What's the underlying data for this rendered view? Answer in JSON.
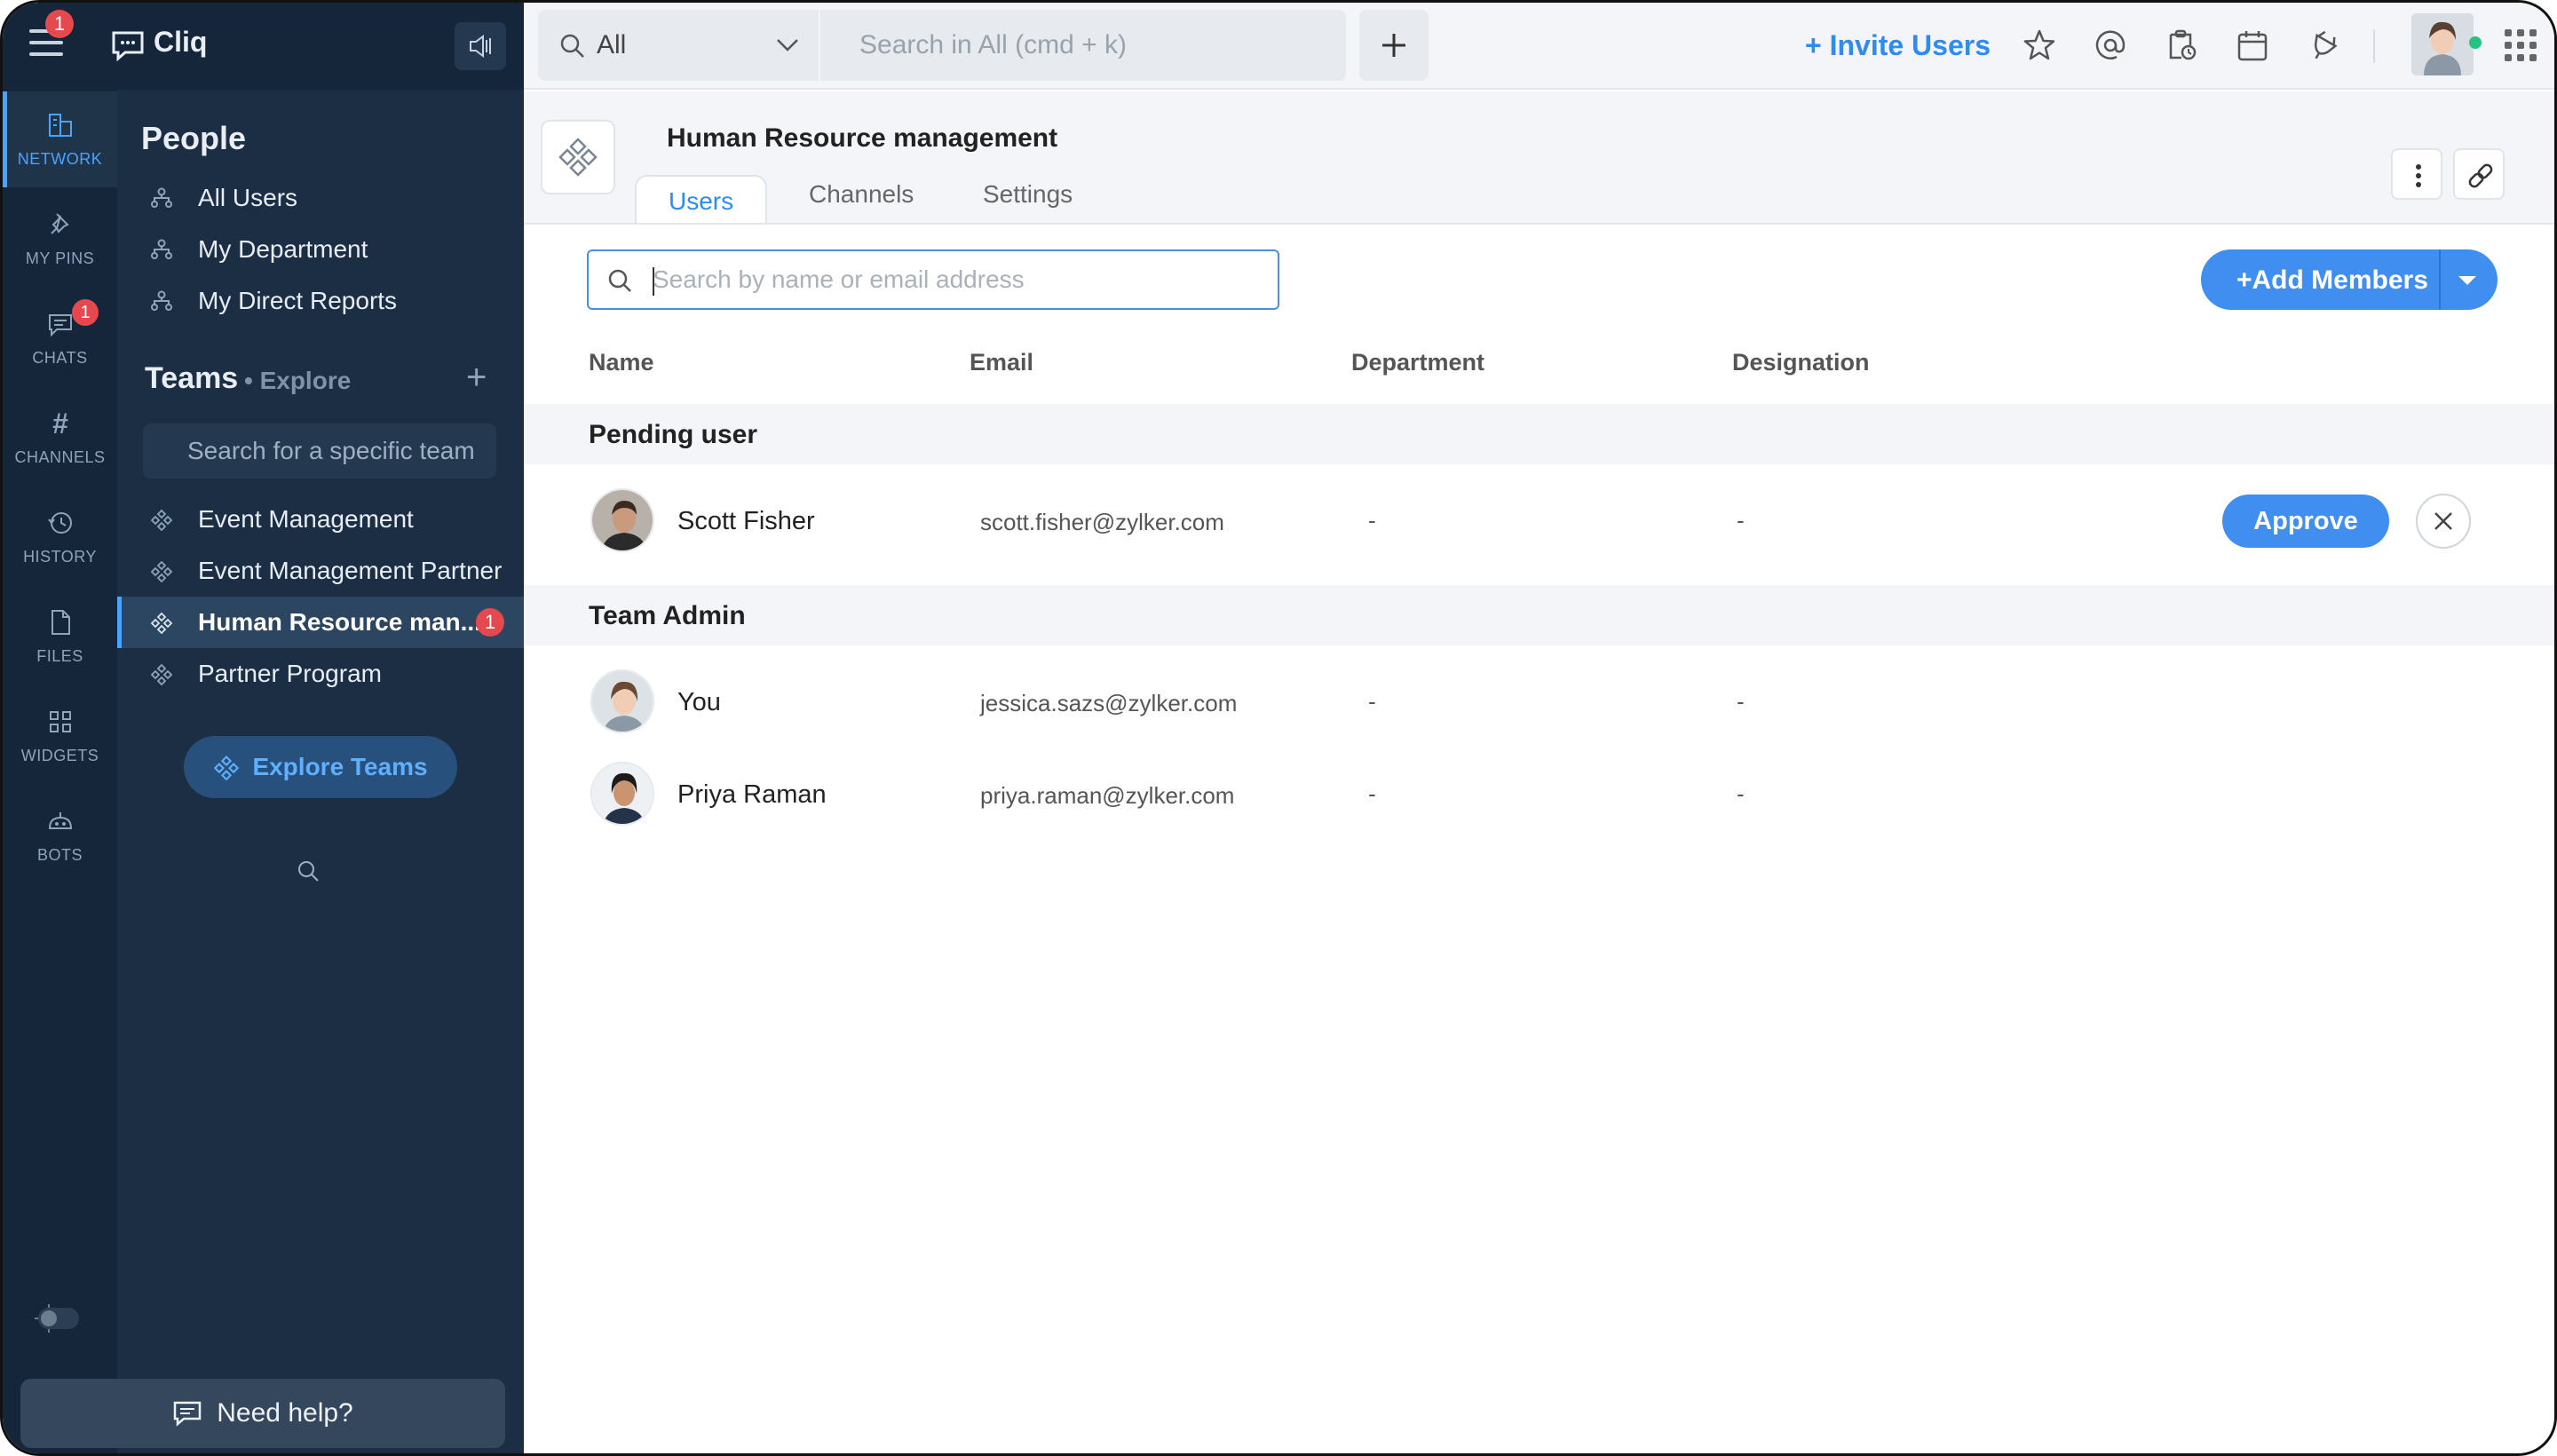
{
  "app": {
    "name": "Cliq",
    "menu_badge": "1"
  },
  "rail": {
    "items": [
      {
        "label": "NETWORK"
      },
      {
        "label": "MY PINS"
      },
      {
        "label": "CHATS",
        "badge": "1"
      },
      {
        "label": "CHANNELS"
      },
      {
        "label": "HISTORY"
      },
      {
        "label": "FILES"
      },
      {
        "label": "WIDGETS"
      },
      {
        "label": "BOTS"
      }
    ]
  },
  "sidebar": {
    "people_title": "People",
    "people_items": [
      "All Users",
      "My Department",
      "My Direct Reports"
    ],
    "teams_title": "Teams",
    "teams_explore": "• Explore",
    "team_search_placeholder": "Search for a specific team",
    "teams": [
      {
        "label": "Event Management"
      },
      {
        "label": "Event Management Partner"
      },
      {
        "label": "Human Resource man...",
        "badge": "1"
      },
      {
        "label": "Partner Program"
      }
    ],
    "explore_button": "Explore Teams",
    "help_button": "Need help?"
  },
  "topbar": {
    "scope": "All",
    "search_placeholder": "Search in All (cmd + k)",
    "invite": "+ Invite Users"
  },
  "team": {
    "title": "Human Resource management",
    "tabs": [
      "Users",
      "Channels",
      "Settings"
    ],
    "active_tab": "Users"
  },
  "members": {
    "search_placeholder": "Search by name or email address",
    "add_button": "+Add Members",
    "columns": [
      "Name",
      "Email",
      "Department",
      "Designation"
    ],
    "groups": [
      {
        "label": "Pending user",
        "users": [
          {
            "name": "Scott Fisher",
            "email": "scott.fisher@zylker.com",
            "department": "-",
            "designation": "-",
            "approve": "Approve"
          }
        ]
      },
      {
        "label": "Team Admin",
        "users": [
          {
            "name": "You",
            "email": "jessica.sazs@zylker.com",
            "department": "-",
            "designation": "-"
          },
          {
            "name": "Priya Raman",
            "email": "priya.raman@zylker.com",
            "department": "-",
            "designation": "-"
          }
        ]
      }
    ]
  },
  "colors": {
    "accent": "#3f8ef0",
    "sidebar_bg": "#1b2e44",
    "rail_bg": "#15263a",
    "badge": "#e5484d"
  }
}
